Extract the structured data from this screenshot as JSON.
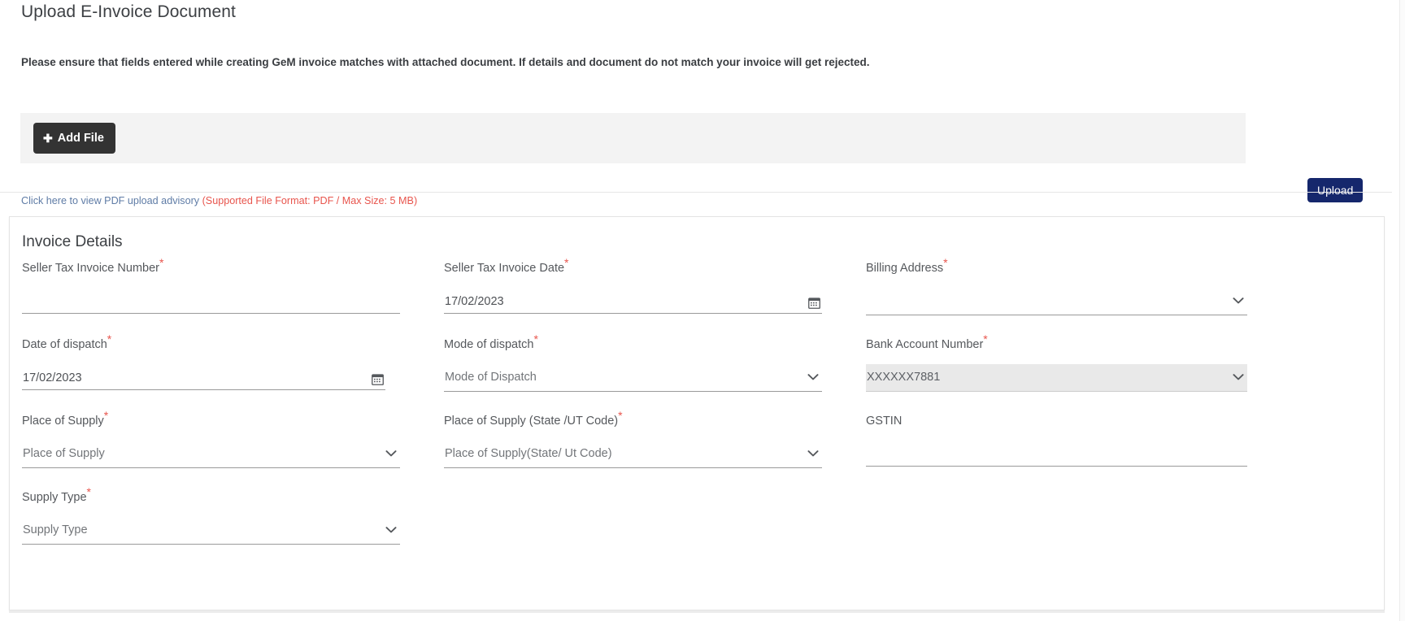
{
  "page": {
    "title": "Upload E-Invoice Document",
    "notice": "Please ensure that fields entered while creating GeM invoice matches with attached document. If details and document do not match your invoice will get rejected."
  },
  "upload": {
    "add_file_label": "Add File",
    "add_file_icon": "plus-icon",
    "upload_label": "Upload",
    "advisory_link_text": "Click here to view PDF upload advisory ",
    "advisory_note_text": "(Supported File Format: PDF / Max Size: 5 MB)",
    "link_color": "#5f7ca6",
    "note_color": "#e8554d",
    "button_color": "#15276c",
    "add_file_color": "#333333"
  },
  "invoice_details": {
    "section_title": "Invoice Details",
    "required_marker": "*",
    "fields": {
      "seller_tax_invoice_number": {
        "label": "Seller Tax Invoice Number",
        "required": true,
        "value": "",
        "placeholder": ""
      },
      "seller_tax_invoice_date": {
        "label": "Seller Tax Invoice Date",
        "required": true,
        "value": "17/02/2023",
        "icon": "calendar-icon"
      },
      "billing_address": {
        "label": "Billing Address",
        "required": true,
        "value": "",
        "icon": "chevron-down-icon"
      },
      "date_of_dispatch": {
        "label": "Date of dispatch",
        "required": true,
        "value": "17/02/2023",
        "icon": "calendar-icon"
      },
      "mode_of_dispatch": {
        "label": "Mode of dispatch",
        "required": true,
        "value": "Mode of Dispatch",
        "icon": "chevron-down-icon"
      },
      "bank_account_number": {
        "label": "Bank Account Number",
        "required": true,
        "value": "XXXXXX7881",
        "icon": "chevron-down-icon",
        "disabled": true
      },
      "place_of_supply": {
        "label": "Place of Supply",
        "required": true,
        "value": "Place of Supply",
        "icon": "chevron-down-icon"
      },
      "place_of_supply_state_ut_code": {
        "label": "Place of Supply (State /UT Code)",
        "required": true,
        "value": "Place of Supply(State/ Ut Code)",
        "icon": "chevron-down-icon"
      },
      "gstin": {
        "label": "GSTIN",
        "required": false,
        "value": "",
        "placeholder": ""
      },
      "supply_type": {
        "label": "Supply Type",
        "required": true,
        "value": "Supply Type",
        "icon": "chevron-down-icon"
      }
    }
  }
}
